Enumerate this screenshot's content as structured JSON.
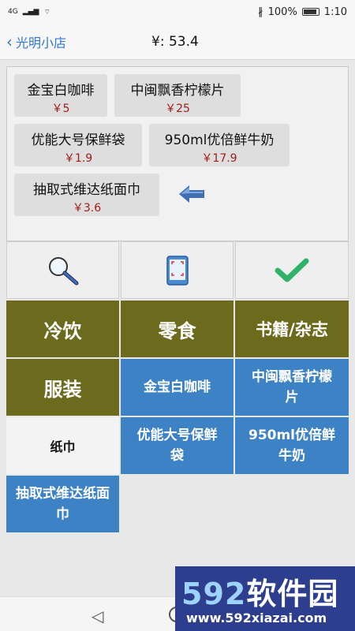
{
  "status_bar": {
    "network": "4G",
    "battery": "100%",
    "time": "1:10"
  },
  "header": {
    "back_label": "光明小店",
    "total": "¥: 53.4"
  },
  "cart": {
    "items": [
      {
        "name": "金宝白咖啡",
        "price": "￥5"
      },
      {
        "name": "中闽飘香柠檬片",
        "price": "￥25"
      },
      {
        "name": "优能大号保鲜袋",
        "price": "￥1.9"
      },
      {
        "name": "950ml优倍鲜牛奶",
        "price": "￥17.9"
      },
      {
        "name": "抽取式维达纸面巾",
        "price": "￥3.6"
      }
    ]
  },
  "tools": {
    "search": "search-icon",
    "scan": "scan-icon",
    "confirm": "check-icon"
  },
  "categories": [
    "冷饮",
    "零食",
    "书籍/杂志",
    "服装",
    "纸巾"
  ],
  "products": [
    "金宝白咖啡",
    "中闽飘香柠檬片",
    "优能大号保鲜袋",
    "950ml优倍鲜牛奶",
    "抽取式维达纸面巾"
  ],
  "watermark": {
    "logo_digits": "592",
    "logo_text": "软件园",
    "url": "www.592xiazai.com"
  },
  "colors": {
    "olive": "#6c6a1c",
    "blue": "#3c82c4",
    "price_red": "#a31b1b",
    "link_blue": "#2f78d3"
  }
}
